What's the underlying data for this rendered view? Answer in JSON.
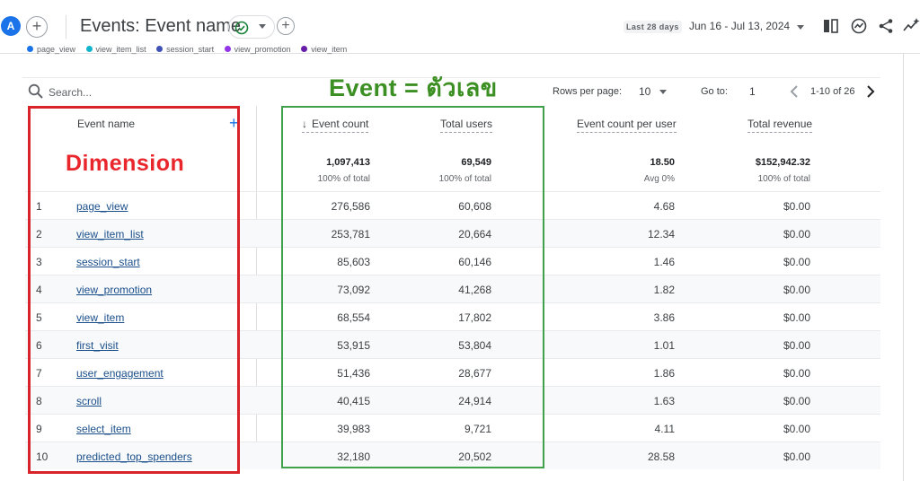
{
  "header": {
    "avatar_letter": "A",
    "title": "Events: Event name",
    "date_chip": "Last 28 days",
    "date_range": "Jun 16 - Jul 13, 2024"
  },
  "legend": [
    {
      "label": "page_view",
      "color": "#1a73e8"
    },
    {
      "label": "view_item_list",
      "color": "#12b5cb"
    },
    {
      "label": "session_start",
      "color": "#3f51b5"
    },
    {
      "label": "view_promotion",
      "color": "#9334e6"
    },
    {
      "label": "view_item",
      "color": "#681da8"
    }
  ],
  "annotations": {
    "green_label": "Event = ตัวเลข",
    "red_label": "Dimension"
  },
  "toolbar": {
    "search_placeholder": "Search...",
    "rows_per_page_label": "Rows per page:",
    "rows_per_page_value": "10",
    "goto_label": "Go to:",
    "goto_value": "1",
    "page_info": "1-10 of 26"
  },
  "table": {
    "headers": {
      "event_name": "Event name",
      "event_count": "Event count",
      "total_users": "Total users",
      "event_count_per_user": "Event count per user",
      "total_revenue": "Total revenue"
    },
    "totals": {
      "event_count": "1,097,413",
      "event_count_sub": "100% of total",
      "total_users": "69,549",
      "total_users_sub": "100% of total",
      "event_count_per_user": "18.50",
      "event_count_per_user_sub": "Avg 0%",
      "total_revenue": "$152,942.32",
      "total_revenue_sub": "100% of total"
    },
    "rows": [
      {
        "idx": "1",
        "name": "page_view",
        "event_count": "276,586",
        "total_users": "60,608",
        "per_user": "4.68",
        "revenue": "$0.00"
      },
      {
        "idx": "2",
        "name": "view_item_list",
        "event_count": "253,781",
        "total_users": "20,664",
        "per_user": "12.34",
        "revenue": "$0.00"
      },
      {
        "idx": "3",
        "name": "session_start",
        "event_count": "85,603",
        "total_users": "60,146",
        "per_user": "1.46",
        "revenue": "$0.00"
      },
      {
        "idx": "4",
        "name": "view_promotion",
        "event_count": "73,092",
        "total_users": "41,268",
        "per_user": "1.82",
        "revenue": "$0.00"
      },
      {
        "idx": "5",
        "name": "view_item",
        "event_count": "68,554",
        "total_users": "17,802",
        "per_user": "3.86",
        "revenue": "$0.00"
      },
      {
        "idx": "6",
        "name": "first_visit",
        "event_count": "53,915",
        "total_users": "53,804",
        "per_user": "1.01",
        "revenue": "$0.00"
      },
      {
        "idx": "7",
        "name": "user_engagement",
        "event_count": "51,436",
        "total_users": "28,677",
        "per_user": "1.86",
        "revenue": "$0.00"
      },
      {
        "idx": "8",
        "name": "scroll",
        "event_count": "40,415",
        "total_users": "24,914",
        "per_user": "1.63",
        "revenue": "$0.00"
      },
      {
        "idx": "9",
        "name": "select_item",
        "event_count": "39,983",
        "total_users": "9,721",
        "per_user": "4.11",
        "revenue": "$0.00"
      },
      {
        "idx": "10",
        "name": "predicted_top_spenders",
        "event_count": "32,180",
        "total_users": "20,502",
        "per_user": "28.58",
        "revenue": "$0.00"
      }
    ]
  }
}
